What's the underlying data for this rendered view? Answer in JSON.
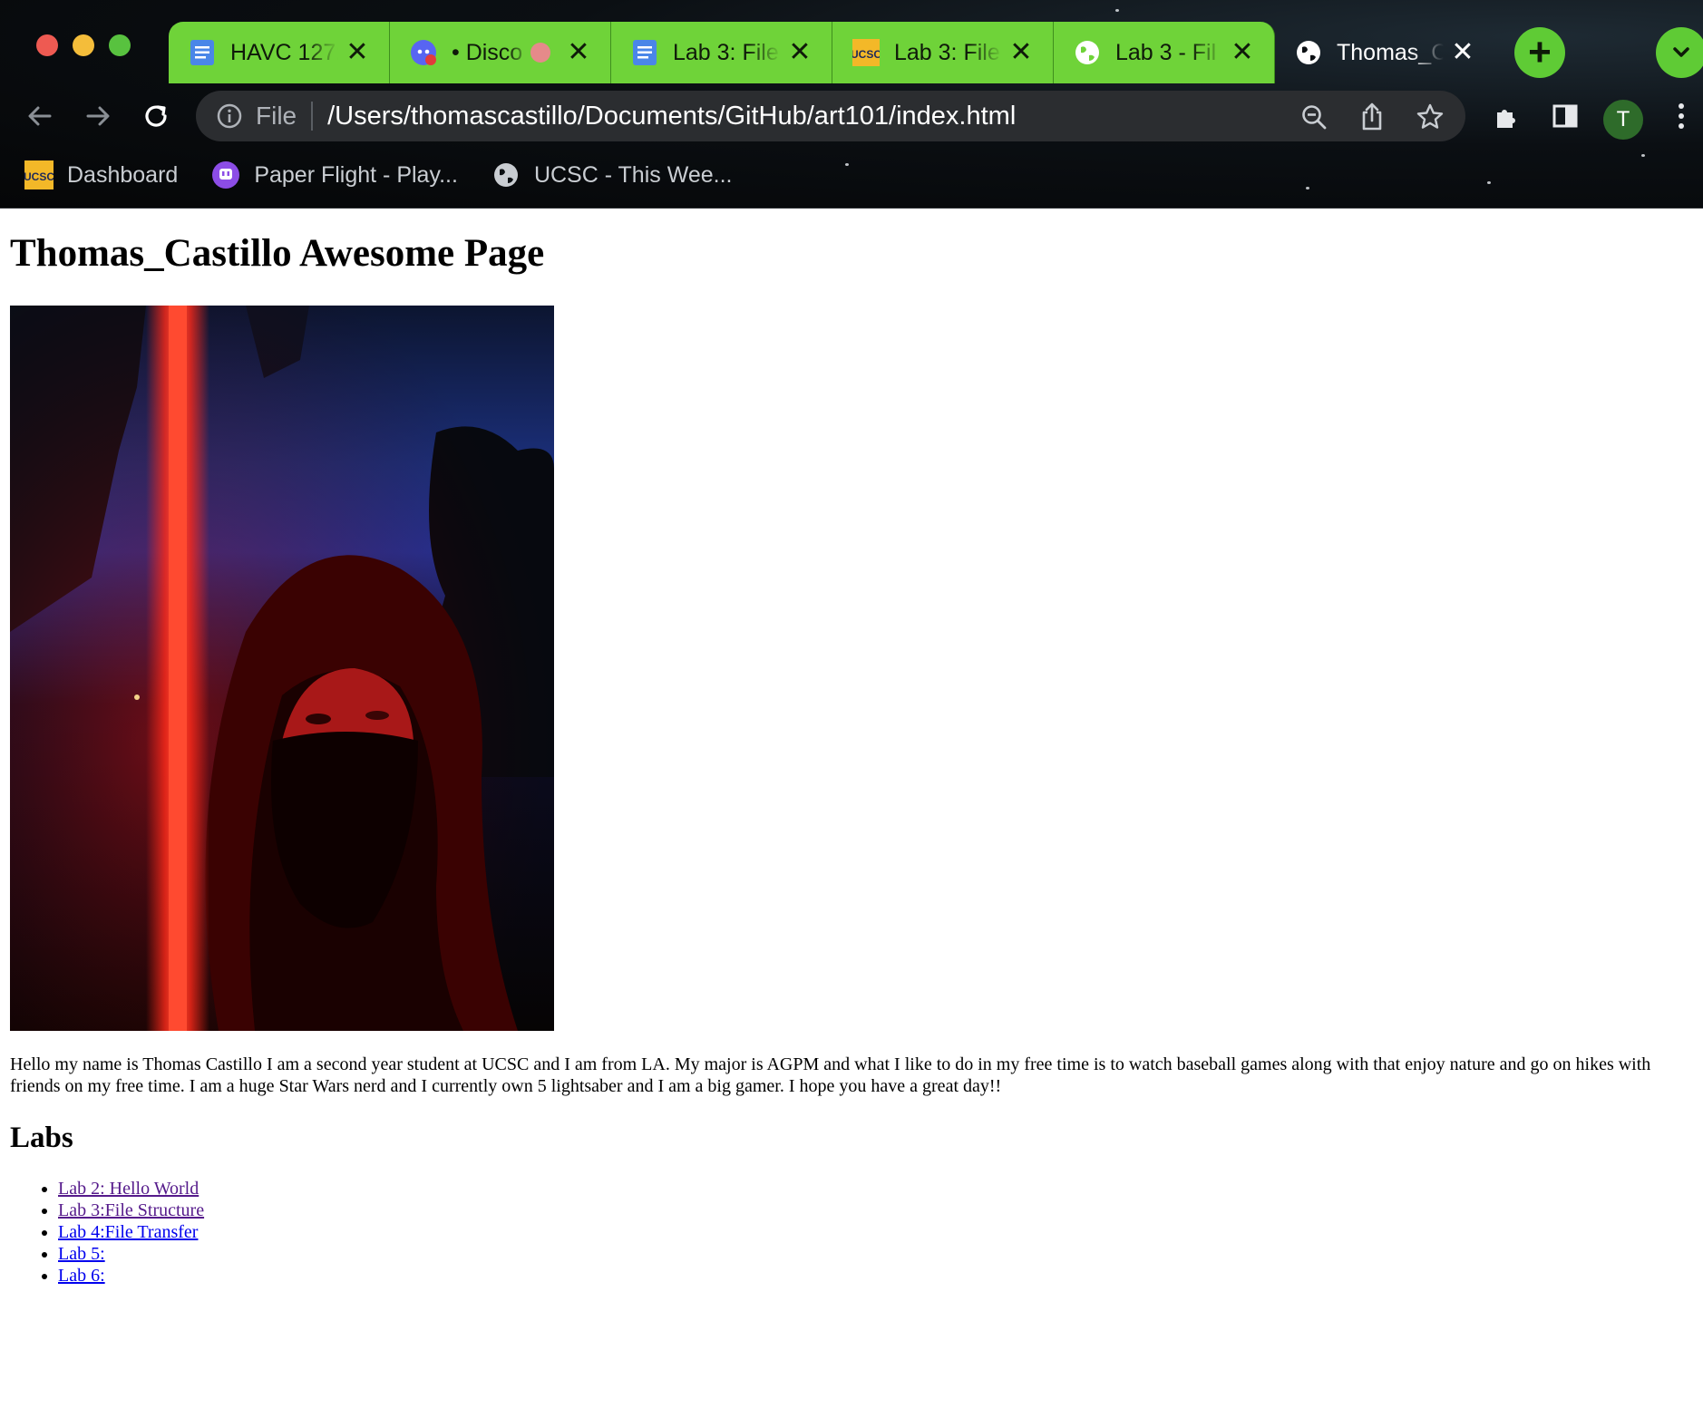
{
  "browser": {
    "tabs": [
      {
        "title": "HAVC 127:",
        "favicon": "google-docs-icon"
      },
      {
        "title": "• Disco",
        "favicon": "discord-icon"
      },
      {
        "title": "Lab 3: File",
        "favicon": "google-docs-icon"
      },
      {
        "title": "Lab 3: File",
        "favicon": "ucsc-icon"
      },
      {
        "title": "Lab 3 - Fil",
        "favicon": "globe-icon"
      },
      {
        "title": "Thomas_C",
        "favicon": "globe-icon",
        "active": true
      }
    ],
    "omnibox": {
      "scheme_label": "File",
      "url": "/Users/thomascastillo/Documents/GitHub/art101/index.html"
    },
    "profile_initial": "T",
    "bookmarks": [
      {
        "label": "Dashboard",
        "icon": "ucsc-icon"
      },
      {
        "label": "Paper Flight - Play...",
        "icon": "twitch-icon"
      },
      {
        "label": "UCSC - This Wee...",
        "icon": "globe-icon"
      }
    ],
    "colors": {
      "tab_group": "#6fd339",
      "toolbar": "#0b0f13",
      "omnibox": "#2b2d30"
    }
  },
  "page": {
    "heading": "Thomas_Castillo Awesome Page",
    "bio": "Hello my name is Thomas Castillo I am a second year student at UCSC and I am from LA. My major is AGPM and what I like to do in my free time is to watch baseball games along with that enjoy nature and go on hikes with friends on my free time. I am a huge Star Wars nerd and I currently own 5 lightsaber and I am a big gamer. I hope you have a great day!!",
    "labs_heading": "Labs",
    "labs": [
      {
        "label": "Lab 2: Hello World",
        "visited": true
      },
      {
        "label": "Lab 3:File Structure",
        "visited": true
      },
      {
        "label": "Lab 4:File Transfer",
        "visited": false
      },
      {
        "label": "Lab 5:",
        "visited": false
      },
      {
        "label": "Lab 6:",
        "visited": false
      }
    ]
  }
}
